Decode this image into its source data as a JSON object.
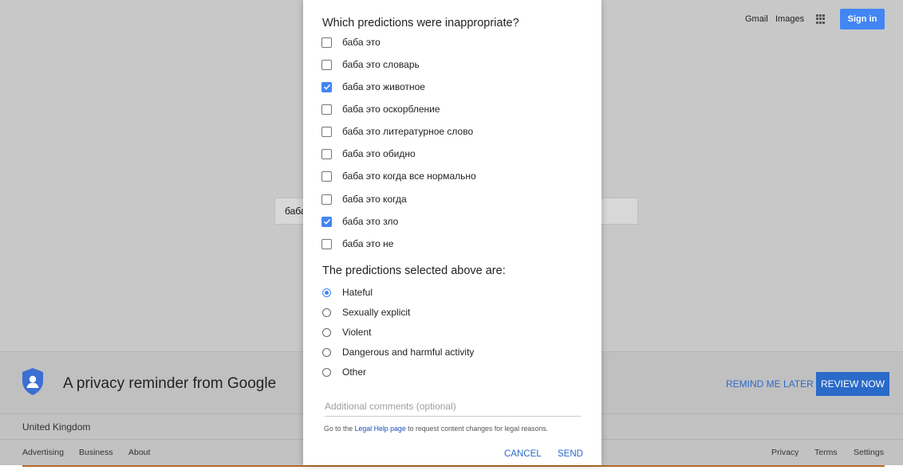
{
  "header": {
    "links": [
      "Gmail",
      "Images"
    ],
    "apps_icon": "apps-grid-icon",
    "sign_in_label": "Sign in"
  },
  "search": {
    "value": "баба"
  },
  "privacy_banner": {
    "icon": "shield-user-icon",
    "title": "A privacy reminder from Google",
    "remind_label": "Remind me later",
    "review_label": "Review now"
  },
  "footer": {
    "country": "United Kingdom",
    "left_links": [
      "Advertising",
      "Business",
      "About"
    ],
    "right_links": [
      "Privacy",
      "Terms",
      "Settings"
    ]
  },
  "dialog": {
    "question": "Which predictions were inappropriate?",
    "predictions": [
      {
        "label": "баба это",
        "checked": false
      },
      {
        "label": "баба это словарь",
        "checked": false
      },
      {
        "label": "баба это животное",
        "checked": true
      },
      {
        "label": "баба это оскорбление",
        "checked": false
      },
      {
        "label": "баба это литературное слово",
        "checked": false
      },
      {
        "label": "баба это обидно",
        "checked": false
      },
      {
        "label": "баба это когда все нормально",
        "checked": false
      },
      {
        "label": "баба это когда",
        "checked": false
      },
      {
        "label": "баба это зло",
        "checked": true
      },
      {
        "label": "баба это не",
        "checked": false
      }
    ],
    "category_question": "The predictions selected above are:",
    "categories": [
      {
        "label": "Hateful",
        "selected": true
      },
      {
        "label": "Sexually explicit",
        "selected": false
      },
      {
        "label": "Violent",
        "selected": false
      },
      {
        "label": "Dangerous and harmful activity",
        "selected": false
      },
      {
        "label": "Other",
        "selected": false
      }
    ],
    "comments_placeholder": "Additional comments (optional)",
    "legal_prefix": "Go to the ",
    "legal_link": "Legal Help page",
    "legal_suffix": " to request content changes for legal reasons.",
    "cancel_label": "Cancel",
    "send_label": "Send"
  },
  "colors": {
    "accent": "#4285f4",
    "link": "#2a6ac9"
  }
}
